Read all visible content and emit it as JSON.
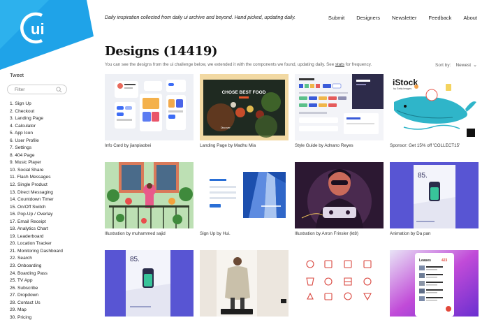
{
  "brand": {
    "logo_text": "ui",
    "colors": {
      "primary": "#1fa3e8",
      "secondary": "#39bdf1"
    }
  },
  "header": {
    "tagline": "Daily inspiration collected from daily ui archive and beyond. Hand picked, updating daily.",
    "nav": [
      "Submit",
      "Designers",
      "Newsletter",
      "Feedback",
      "About"
    ]
  },
  "sidebar": {
    "tweet_label": "Tweet",
    "filter_placeholder": "Filter",
    "items": [
      "1. Sign Up",
      "2. Checkout",
      "3. Landing Page",
      "4. Calculator",
      "5. App Icon",
      "6. User Profile",
      "7. Settings",
      "8. 404 Page",
      "9. Music Player",
      "10. Social Share",
      "11. Flash Messages",
      "12. Single Product",
      "13. Direct Messaging",
      "14. Countdown Timer",
      "15. On/Off Switch",
      "16. Pop-Up / Overlay",
      "17. Email Receipt",
      "18. Analytics Chart",
      "19. Leaderboard",
      "20. Location Tracker",
      "21. Monitoring Dashboard",
      "22. Search",
      "23. Onboarding",
      "24. Boarding Pass",
      "25. TV App",
      "26. Subscribe",
      "27. Dropdown",
      "28. Contact Us",
      "29. Map",
      "30. Pricing"
    ]
  },
  "main": {
    "title": "Designs (14419)",
    "subtitle_before": "You can see the designs from the ui challenge below, we extended it with the components we found, updating daily. See ",
    "subtitle_link": "stats",
    "subtitle_after": " for frequency.",
    "sort_label": "Sort by:",
    "sort_value": "Newest",
    "cards": [
      {
        "caption": "Info Card by jianpiaobei"
      },
      {
        "caption": "Landing Page by Madhu Mia",
        "thumb_text": "CHOSE BEST FOOD",
        "thumb_sub": "Discover"
      },
      {
        "caption": "Style Guide by Adnano Reyes"
      },
      {
        "caption": "Sponsor: Get 15% off 'COLLECT15'",
        "thumb_text": "iStock",
        "thumb_sub": "by Getty Images"
      },
      {
        "caption": "Illustration by muhammed sajid"
      },
      {
        "caption": "Sign Up by Hui."
      },
      {
        "caption": "Illustration by Arron Frinsler (kt8)"
      },
      {
        "caption": "Animation by Da pan",
        "thumb_text": "85."
      },
      {
        "caption": "",
        "thumb_text": "85."
      },
      {
        "caption": ""
      },
      {
        "caption": ""
      },
      {
        "caption": "",
        "thumb_text": "Leases",
        "thumb_sub": "423"
      }
    ]
  }
}
